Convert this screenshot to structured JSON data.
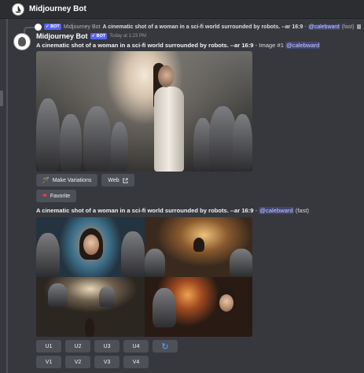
{
  "channel": {
    "title": "Midjourney Bot"
  },
  "reply": {
    "username": "Midjourney Bot",
    "badge": "BOT",
    "prompt": "A cinematic shot of a woman in a sci-fi world surrounded by robots. --ar 16:9",
    "separator": " - ",
    "mention": "@calebward",
    "suffix": " (fast)"
  },
  "message": {
    "username": "Midjourney Bot",
    "badge": "BOT",
    "timestamp": "Today at 1:23 PM",
    "prompt": "A cinematic shot of a woman in a sci-fi world surrounded by robots. --ar 16:9",
    "separator": " - ",
    "image_label": "Image #1",
    "mention": "@calebward",
    "buttons": {
      "make_variations": "Make Variations",
      "web": "Web",
      "favorite": "Favorite"
    }
  },
  "grid_message": {
    "prompt": "A cinematic shot of a woman in a sci-fi world surrounded by robots. --ar 16:9",
    "separator": " - ",
    "mention": "@calebward",
    "suffix": " (fast)",
    "upscale_buttons": [
      "U1",
      "U2",
      "U3",
      "U4"
    ],
    "variation_buttons": [
      "V1",
      "V2",
      "V3",
      "V4"
    ],
    "reroll_icon": "refresh-icon"
  },
  "icons": [
    "discord-bot-avatar-icon",
    "verified-check-icon",
    "image-icon",
    "wand-icon",
    "external-link-icon",
    "heart-icon",
    "refresh-icon"
  ],
  "colors": {
    "background": "#36383d",
    "button": "#4e5058",
    "accent": "#5865f2",
    "heart": "#f23f43",
    "refresh": "#5aa9f2"
  }
}
